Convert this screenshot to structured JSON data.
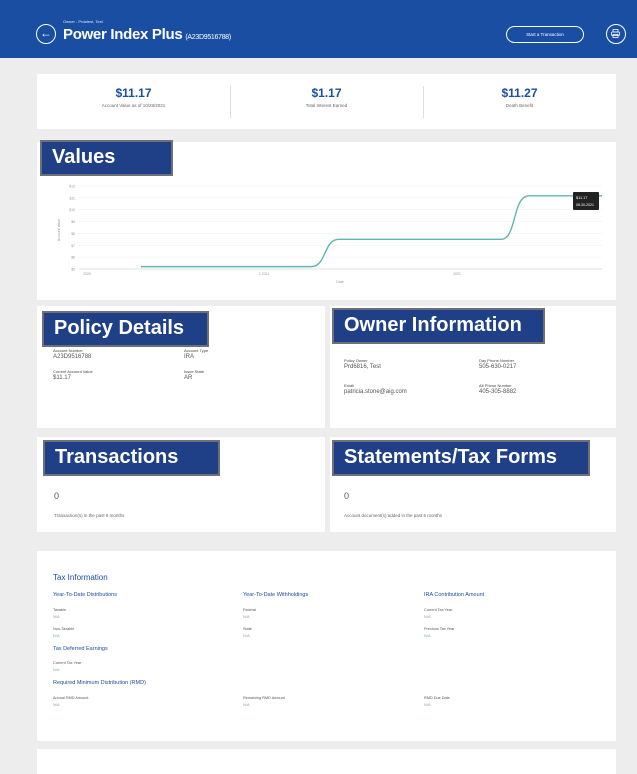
{
  "header": {
    "subtitle": "Owner - Prdatest, Test",
    "title": "Power Index Plus",
    "policy_number": "(A23D9516788)",
    "start_button": "Start a Transaction"
  },
  "summary": [
    {
      "value": "$11.17",
      "label": "Account Value as of 10/28/2021"
    },
    {
      "value": "$1.17",
      "label": "Total Interest Earned"
    },
    {
      "value": "$11.27",
      "label": "Death Benefit"
    }
  ],
  "values": {
    "heading": "Values",
    "chart_data": {
      "type": "line",
      "title": "",
      "xlabel": "Date",
      "ylabel": "Account Value",
      "y_ticks": [
        "$12",
        "$11",
        "$10",
        "$9",
        "$8",
        "$7",
        "$6",
        "$5"
      ],
      "x_ticks": [
        "2020",
        "7-2021",
        "2021"
      ],
      "ylim": [
        5,
        12
      ],
      "series": [
        {
          "color": "#5fb7b0",
          "x": [
            "2020-01",
            "2020-07",
            "2020-12",
            "2021-01",
            "2021-04",
            "2021-07",
            "2021-10"
          ],
          "values": [
            5.2,
            5.2,
            5.2,
            7.5,
            7.5,
            7.5,
            11.17
          ]
        }
      ],
      "tooltip": {
        "value": "$11.17",
        "date": "08-30-2021"
      },
      "grid": true
    }
  },
  "policy_details": {
    "heading": "Policy Details",
    "fields": [
      {
        "label": "Account Number",
        "value": "A23D9516788"
      },
      {
        "label": "Account Type",
        "value": "IRA"
      },
      {
        "label": "Current Account Value",
        "value": "$11.17"
      },
      {
        "label": "Issue State",
        "value": "AR"
      }
    ]
  },
  "owner_information": {
    "heading": "Owner Information",
    "fields": [
      {
        "label": "Policy Owner",
        "value": "Prd6816, Test"
      },
      {
        "label": "Day Phone Number",
        "value": "505-630-0217"
      },
      {
        "label": "Email",
        "value": "patricia.stone@aig.com"
      },
      {
        "label": "Alt Phone Number",
        "value": "405-305-8882"
      }
    ]
  },
  "transactions": {
    "heading": "Transactions",
    "count": "0",
    "note": "Transaction(s) in the past 6 months"
  },
  "statements": {
    "heading": "Statements/Tax Forms",
    "count": "0",
    "note": "Account document(s) added in the past 6 months"
  },
  "tax": {
    "title": "Tax Information",
    "ytd_distributions": "Year-To-Date Distributions",
    "ytd_withholdings": "Year-To-Date Withholdings",
    "ira_contribution": "IRA Contribution Amount",
    "taxable_label": "Taxable",
    "taxable_value": "N/A",
    "non_taxable_label": "Non-Taxable",
    "non_taxable_value": "N/A",
    "federal_label": "Federal",
    "federal_value": "N/A",
    "state_label": "State",
    "state_value": "N/A",
    "current_tax_year_label": "Current Tax Year",
    "current_tax_year_value": "N/A",
    "previous_tax_year_label": "Previous Tax Year",
    "previous_tax_year_value": "N/A",
    "tax_deferred": "Tax Deferred Earnings",
    "tde_current_label": "Current Tax Year",
    "tde_current_value": "N/A",
    "rmd_heading": "Required Minimum Distribution (RMD)",
    "annual_rmd_label": "Annual RMD Amount",
    "annual_rmd_value": "N/A",
    "remaining_rmd_label": "Remaining RMD Amount",
    "remaining_rmd_value": "N/A",
    "rmd_due_label": "RMD Due Date",
    "rmd_due_value": "N/A"
  },
  "colors": {
    "brand": "#1a4ea3",
    "banner": "#1f3f87",
    "line": "#5fb7b0"
  }
}
